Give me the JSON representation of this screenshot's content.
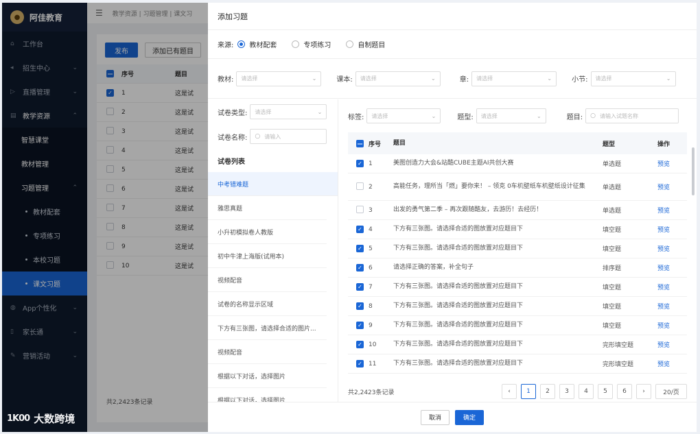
{
  "sidebar": {
    "brand": "阿佳教育",
    "items": [
      {
        "label": "工作台",
        "icon": "home-icon"
      },
      {
        "label": "招生中心",
        "icon": "megaphone-icon"
      },
      {
        "label": "直播管理",
        "icon": "video-icon"
      },
      {
        "label": "教学资源",
        "icon": "book-icon"
      }
    ],
    "sub": {
      "smart": "智慧课堂",
      "material": "教材管理",
      "exercise": "习题管理"
    },
    "sub2": [
      "教材配套",
      "专项练习",
      "本校习题",
      "课文习题"
    ],
    "after": [
      {
        "label": "App个性化",
        "icon": "palette-icon"
      },
      {
        "label": "家长通",
        "icon": "phone-icon"
      },
      {
        "label": "营销活动",
        "icon": "gift-icon"
      }
    ]
  },
  "bg": {
    "breadcrumb": "教学资源 | 习题管理 | 课文习",
    "publish": "发布",
    "add_existing": "添加已有题目",
    "col_no": "序号",
    "col_title": "题目",
    "rows": [
      {
        "no": "1",
        "title": "这是试"
      },
      {
        "no": "2",
        "title": "这是试"
      },
      {
        "no": "3",
        "title": "这是试"
      },
      {
        "no": "4",
        "title": "这是试"
      },
      {
        "no": "5",
        "title": "这是试"
      },
      {
        "no": "6",
        "title": "这是试"
      },
      {
        "no": "7",
        "title": "这是试"
      },
      {
        "no": "8",
        "title": "这是试"
      },
      {
        "no": "9",
        "title": "这是试"
      },
      {
        "no": "10",
        "title": "这是试"
      }
    ],
    "total": "共2,2423条记录"
  },
  "modal": {
    "title": "添加习题",
    "source_label": "来源:",
    "sources": [
      "教材配套",
      "专项练习",
      "自制题目"
    ],
    "filters": {
      "textbook": "教材:",
      "volume": "课本:",
      "chapter": "章:",
      "section": "小节:",
      "placeholder": "请选择"
    },
    "left": {
      "paper_type": "试卷类型:",
      "paper_name": "试卷名称:",
      "input_placeholder": "请输入",
      "list_title": "试卷列表",
      "papers": [
        "中考错难题",
        "雅思真题",
        "小升初模拟卷人教版",
        "初中牛津上海版(试用本)",
        "视频配音",
        "试卷的名称显示区域",
        "下方有三张图，请选择合适的图片...",
        "视频配音",
        "根据以下对话，选择图片",
        "根据以下对话，选择图片"
      ]
    },
    "right": {
      "tag": "标签:",
      "qtype": "题型:",
      "question": "题目:",
      "q_placeholder": "请输入试题名称",
      "headers": {
        "no": "序号",
        "title": "题目",
        "type": "题型",
        "op": "操作"
      },
      "rows": [
        {
          "no": "1",
          "title": "美图创造力大会&站酷CUBE主题AI共创大赛",
          "type": "单选题",
          "op": "预览",
          "checked": true
        },
        {
          "no": "2",
          "title": "高能任务，理所当「燃」要你来！ – 领克 0车机壁纸车机壁纸设计征集",
          "type": "单选题",
          "op": "预览",
          "checked": false
        },
        {
          "no": "3",
          "title": "出发的勇气第二季 – 再次跟随酷友，去游历！去经历！",
          "type": "单选题",
          "op": "预览",
          "checked": false
        },
        {
          "no": "4",
          "title": "下方有三张图。请选择合适的图放置对应题目下",
          "type": "填空题",
          "op": "预览",
          "checked": true
        },
        {
          "no": "5",
          "title": "下方有三张图。请选择合适的图放置对应题目下",
          "type": "填空题",
          "op": "预览",
          "checked": true
        },
        {
          "no": "6",
          "title": "请选择正确的答案，补全句子",
          "type": "排序题",
          "op": "预览",
          "checked": true
        },
        {
          "no": "7",
          "title": "下方有三张图。请选择合适的图放置对应题目下",
          "type": "填空题",
          "op": "预览",
          "checked": true
        },
        {
          "no": "8",
          "title": "下方有三张图。请选择合适的图放置对应题目下",
          "type": "填空题",
          "op": "预览",
          "checked": true
        },
        {
          "no": "9",
          "title": "下方有三张图。请选择合适的图放置对应题目下",
          "type": "填空题",
          "op": "预览",
          "checked": true
        },
        {
          "no": "10",
          "title": "下方有三张图。请选择合适的图放置对应题目下",
          "type": "完形填空题",
          "op": "预览",
          "checked": true
        },
        {
          "no": "11",
          "title": "下方有三张图。请选择合适的图放置对应题目下",
          "type": "完形填空题",
          "op": "预览",
          "checked": true
        }
      ],
      "total": "共2,2423条记录",
      "pages": [
        "1",
        "2",
        "3",
        "4",
        "5",
        "6"
      ],
      "page_size": "20/页"
    },
    "cancel": "取消",
    "ok": "确定"
  },
  "watermark": {
    "logo": "1K00",
    "text": "大数跨境"
  },
  "colors": {
    "primary": "#1a66d6",
    "sidebar": "#0f1b2d"
  }
}
